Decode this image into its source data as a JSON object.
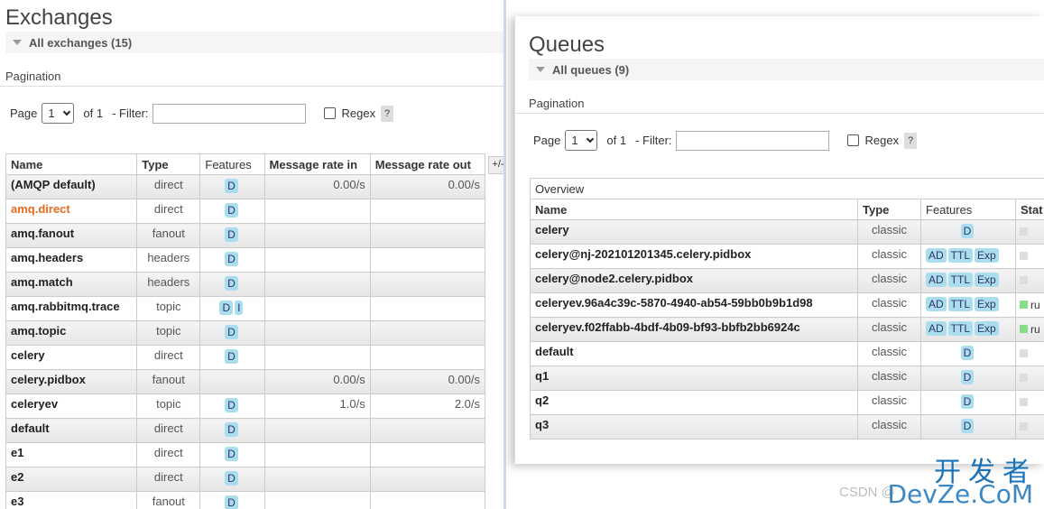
{
  "exchanges": {
    "title": "Exchanges",
    "section": "All exchanges (15)",
    "pagination_label": "Pagination",
    "page_label": "Page",
    "page_value": "1",
    "of_label": "of 1",
    "filter_label": "- Filter:",
    "regex_label": "Regex",
    "help": "?",
    "plus_minus": "+/-",
    "columns": [
      "Name",
      "Type",
      "Features",
      "Message rate in",
      "Message rate out"
    ],
    "rows": [
      {
        "name": "(AMQP default)",
        "type": "direct",
        "features": [
          "D"
        ],
        "rate_in": "0.00/s",
        "rate_out": "0.00/s"
      },
      {
        "name": "amq.direct",
        "type": "direct",
        "features": [
          "D"
        ],
        "rate_in": "",
        "rate_out": ""
      },
      {
        "name": "amq.fanout",
        "type": "fanout",
        "features": [
          "D"
        ],
        "rate_in": "",
        "rate_out": ""
      },
      {
        "name": "amq.headers",
        "type": "headers",
        "features": [
          "D"
        ],
        "rate_in": "",
        "rate_out": ""
      },
      {
        "name": "amq.match",
        "type": "headers",
        "features": [
          "D"
        ],
        "rate_in": "",
        "rate_out": ""
      },
      {
        "name": "amq.rabbitmq.trace",
        "type": "topic",
        "features": [
          "D",
          "I"
        ],
        "rate_in": "",
        "rate_out": ""
      },
      {
        "name": "amq.topic",
        "type": "topic",
        "features": [
          "D"
        ],
        "rate_in": "",
        "rate_out": ""
      },
      {
        "name": "celery",
        "type": "direct",
        "features": [
          "D"
        ],
        "rate_in": "",
        "rate_out": ""
      },
      {
        "name": "celery.pidbox",
        "type": "fanout",
        "features": [],
        "rate_in": "0.00/s",
        "rate_out": "0.00/s"
      },
      {
        "name": "celeryev",
        "type": "topic",
        "features": [
          "D"
        ],
        "rate_in": "1.0/s",
        "rate_out": "2.0/s"
      },
      {
        "name": "default",
        "type": "direct",
        "features": [
          "D"
        ],
        "rate_in": "",
        "rate_out": ""
      },
      {
        "name": "e1",
        "type": "direct",
        "features": [
          "D"
        ],
        "rate_in": "",
        "rate_out": ""
      },
      {
        "name": "e2",
        "type": "direct",
        "features": [
          "D"
        ],
        "rate_in": "",
        "rate_out": ""
      },
      {
        "name": "e3",
        "type": "fanout",
        "features": [
          "D"
        ],
        "rate_in": "",
        "rate_out": ""
      }
    ]
  },
  "queues": {
    "title": "Queues",
    "section": "All queues (9)",
    "pagination_label": "Pagination",
    "page_label": "Page",
    "page_value": "1",
    "of_label": "of 1",
    "filter_label": "- Filter:",
    "regex_label": "Regex",
    "help": "?",
    "overview_label": "Overview",
    "columns": [
      "Name",
      "Type",
      "Features",
      "Stat"
    ],
    "rows": [
      {
        "name": "celery",
        "type": "classic",
        "features": [
          "D"
        ],
        "state": ""
      },
      {
        "name": "celery@nj-202101201345.celery.pidbox",
        "type": "classic",
        "features": [
          "AD",
          "TTL",
          "Exp"
        ],
        "state": ""
      },
      {
        "name": "celery@node2.celery.pidbox",
        "type": "classic",
        "features": [
          "AD",
          "TTL",
          "Exp"
        ],
        "state": ""
      },
      {
        "name": "celeryev.96a4c39c-5870-4940-ab54-59bb0b9b1d98",
        "type": "classic",
        "features": [
          "AD",
          "TTL",
          "Exp"
        ],
        "state": "ru"
      },
      {
        "name": "celeryev.f02ffabb-4bdf-4b09-bf93-bbfb2bb6924c",
        "type": "classic",
        "features": [
          "AD",
          "TTL",
          "Exp"
        ],
        "state": "ru"
      },
      {
        "name": "default",
        "type": "classic",
        "features": [
          "D"
        ],
        "state": ""
      },
      {
        "name": "q1",
        "type": "classic",
        "features": [
          "D"
        ],
        "state": ""
      },
      {
        "name": "q2",
        "type": "classic",
        "features": [
          "D"
        ],
        "state": ""
      },
      {
        "name": "q3",
        "type": "classic",
        "features": [
          "D"
        ],
        "state": ""
      }
    ]
  },
  "watermark": {
    "cn": "开发者",
    "en": "DevZe.CoM",
    "csdn": "CSDN @"
  }
}
